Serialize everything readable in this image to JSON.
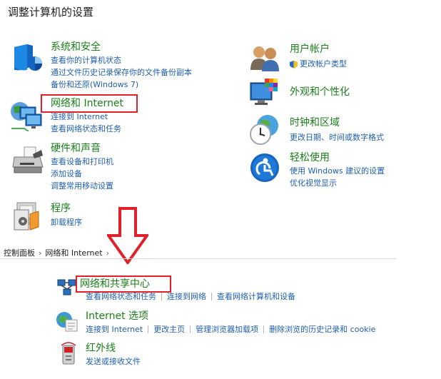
{
  "page_title": "调整计算机的设置",
  "categories_left": [
    {
      "title": "系统和安全",
      "links": [
        "查看你的计算机状态",
        "通过文件历史记录保存你的文件备份副本",
        "备份和还原(Windows 7)"
      ]
    },
    {
      "title": "网络和 Internet",
      "links": [
        "连接到 Internet",
        "查看网络状态和任务"
      ]
    },
    {
      "title": "硬件和声音",
      "links": [
        "查看设备和打印机",
        "添加设备",
        "调整常用移动设置"
      ]
    },
    {
      "title": "程序",
      "links": [
        "卸载程序"
      ]
    }
  ],
  "categories_right": [
    {
      "title": "用户帐户",
      "links": [
        "更改帐户类型"
      ]
    },
    {
      "title": "外观和个性化",
      "links": []
    },
    {
      "title": "时钟和区域",
      "links": [
        "更改日期、时间或数字格式"
      ]
    },
    {
      "title": "轻松使用",
      "links": [
        "使用 Windows 建议的设置",
        "优化视觉显示"
      ]
    }
  ],
  "breadcrumb": [
    "控制面板",
    "网络和 Internet"
  ],
  "sub_sections": [
    {
      "title": "网络和共享中心",
      "links": [
        "查看网络状态和任务",
        "连接到网络",
        "查看网络计算机和设备"
      ]
    },
    {
      "title": "Internet 选项",
      "links": [
        "连接到 Internet",
        "更改主页",
        "管理浏览器加载项",
        "删除浏览的历史记录和 cookie"
      ]
    },
    {
      "title": "红外线",
      "links": [
        "发送或接收文件"
      ]
    }
  ],
  "icons": {
    "system_security": "shield-icon",
    "network": "network-monitors-icon",
    "hardware": "printer-icon",
    "programs": "programs-icon",
    "user_accounts": "users-icon",
    "appearance": "monitor-palette-icon",
    "clock": "clock-globe-icon",
    "ease": "ease-of-access-icon",
    "sharing_center": "network-sharing-icon",
    "internet_options": "globe-document-icon",
    "infrared": "infrared-icon"
  },
  "colors": {
    "category_green": "#1a7f1a",
    "link_blue": "#1f5fb0",
    "highlight_red": "#e0202a"
  }
}
